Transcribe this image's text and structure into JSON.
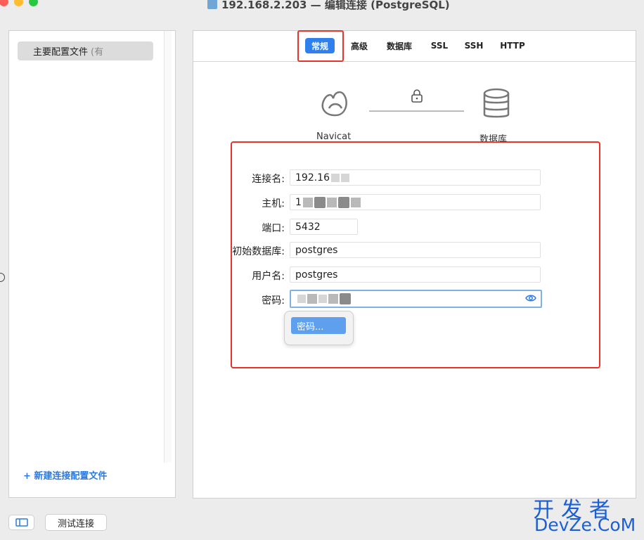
{
  "window": {
    "title": "192.168.2.203 — 编辑连接 (PostgreSQL)",
    "colors": {
      "close": "#ff5f57",
      "minimize": "#febc2e",
      "zoom": "#28c840"
    }
  },
  "sidebar": {
    "profile_label": "主要配置文件",
    "profile_hint": "(有",
    "new_profile_label": "+ 新建连接配置文件"
  },
  "tabs": [
    {
      "label": "常规",
      "active": true
    },
    {
      "label": "高级",
      "active": false
    },
    {
      "label": "数据库",
      "active": false
    },
    {
      "label": "SSL",
      "active": false
    },
    {
      "label": "SSH",
      "active": false
    },
    {
      "label": "HTTP",
      "active": false
    }
  ],
  "diagram": {
    "left_label": "Navicat",
    "right_label": "数据库"
  },
  "form": {
    "connection_name_label": "连接名:",
    "connection_name_value": "192.16",
    "host_label": "主机:",
    "host_value": "1",
    "port_label": "端口:",
    "port_value": "5432",
    "initial_db_label": "初始数据库:",
    "initial_db_value": "postgres",
    "username_label": "用户名:",
    "username_value": "postgres",
    "password_label": "密码:",
    "password_popup_label": "密码..."
  },
  "bottom": {
    "test_connection_label": "测试连接"
  },
  "watermark": {
    "cn": "开发者",
    "en": "DevZe.CoM"
  },
  "accent": {
    "highlight_red": "#e8332a",
    "tab_blue": "#2f80ed",
    "link_blue": "#2b7ae0"
  }
}
